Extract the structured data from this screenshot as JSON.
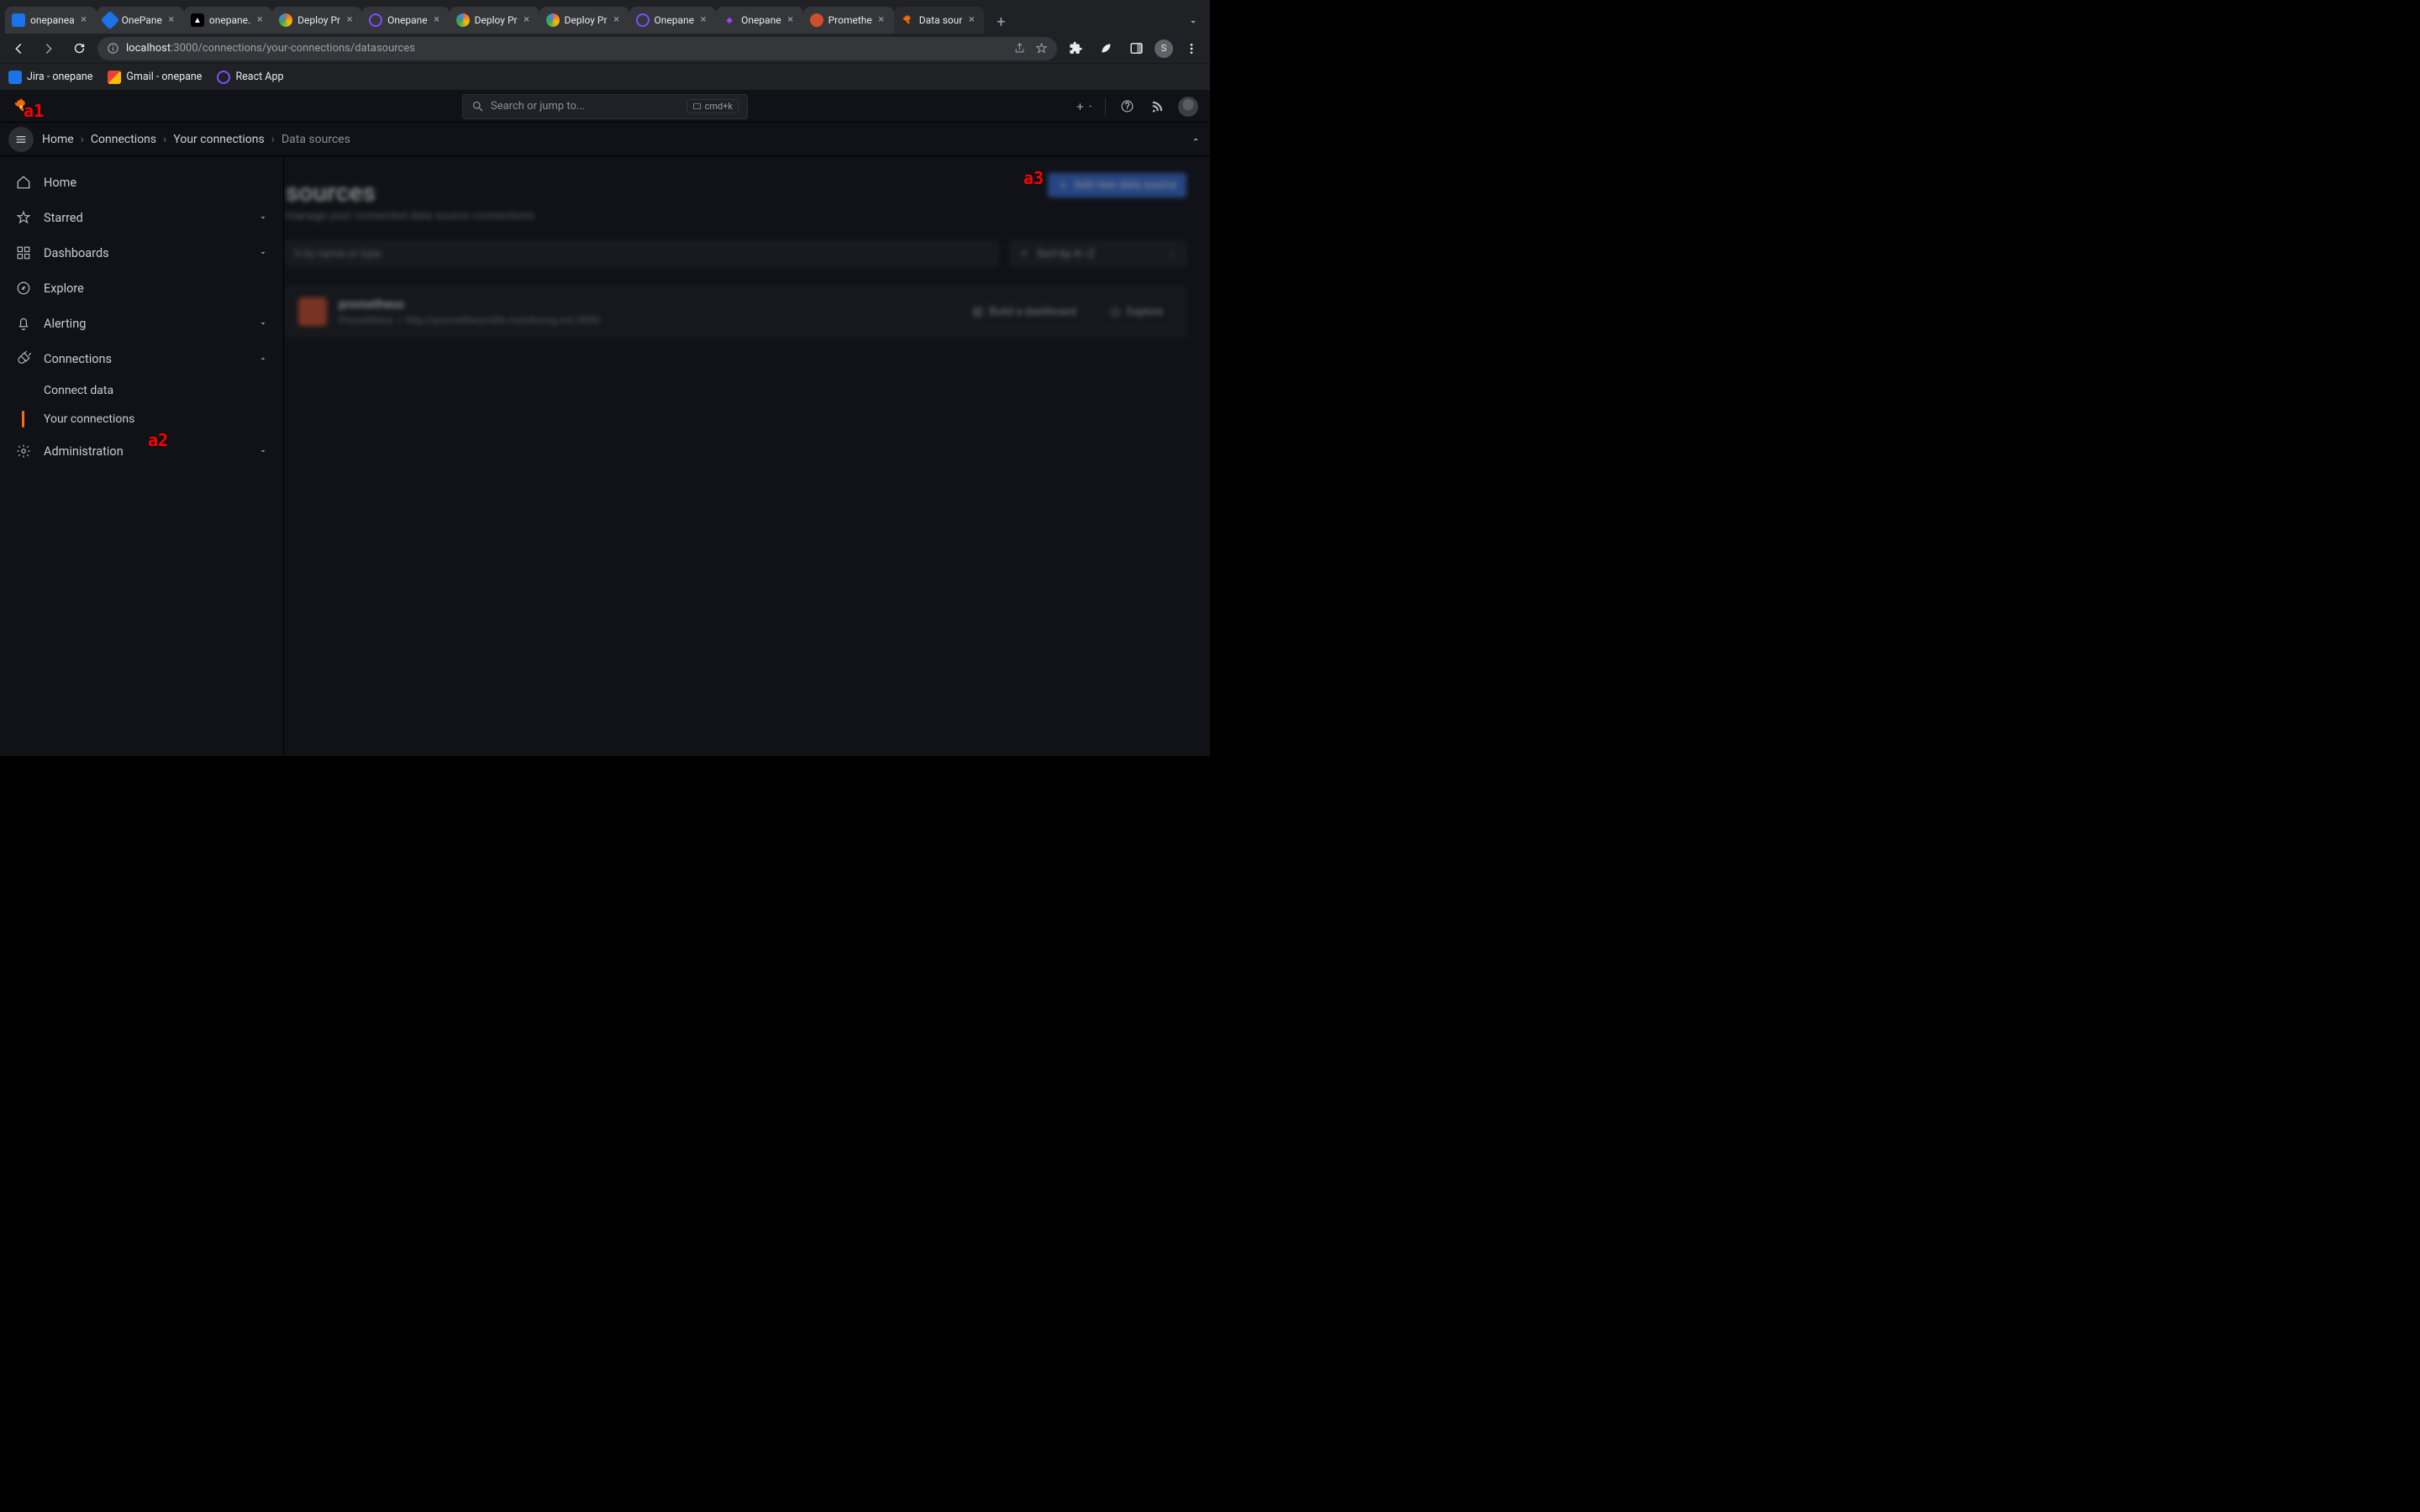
{
  "browser": {
    "tabs": [
      {
        "title": "onepanea",
        "favicon_color": "#1a73e8",
        "favicon_text": ""
      },
      {
        "title": "OnePane",
        "favicon_color": "#1a73e8",
        "favicon_text": ""
      },
      {
        "title": "onepane.",
        "favicon_color": "#ffffff",
        "favicon_text": "▲"
      },
      {
        "title": "Deploy Pr",
        "favicon_color": "#f25c2e",
        "favicon_text": ""
      },
      {
        "title": "Onepane",
        "favicon_color": "#7c4dff",
        "favicon_text": ""
      },
      {
        "title": "Deploy Pr",
        "favicon_color": "#f25c2e",
        "favicon_text": ""
      },
      {
        "title": "Deploy Pr",
        "favicon_color": "#f25c2e",
        "favicon_text": ""
      },
      {
        "title": "Onepane",
        "favicon_color": "#7c4dff",
        "favicon_text": ""
      },
      {
        "title": "Onepane",
        "favicon_color": "",
        "favicon_text": "◆"
      },
      {
        "title": "Promethe",
        "favicon_color": "#cf4f2d",
        "favicon_text": ""
      },
      {
        "title": "Data sour",
        "favicon_color": "#f46800",
        "favicon_text": "",
        "active": true
      }
    ],
    "url_muted_prefix": "localhost",
    "url_rest": ":3000/connections/your-connections/datasources",
    "bookmarks": [
      {
        "label": "Jira - onepane",
        "color": "#1a73e8"
      },
      {
        "label": "Gmail - onepane",
        "color": "#ea4335"
      },
      {
        "label": "React App",
        "color": "#7c4dff"
      }
    ],
    "avatar_letter": "S"
  },
  "app": {
    "search_placeholder": "Search or jump to...",
    "search_shortcut": "cmd+k",
    "breadcrumbs": [
      "Home",
      "Connections",
      "Your connections",
      "Data sources"
    ],
    "sidenav": [
      {
        "label": "Home",
        "icon": "home"
      },
      {
        "label": "Starred",
        "icon": "star",
        "expandable": true
      },
      {
        "label": "Dashboards",
        "icon": "dashboards",
        "expandable": true
      },
      {
        "label": "Explore",
        "icon": "compass"
      },
      {
        "label": "Alerting",
        "icon": "bell",
        "expandable": true
      },
      {
        "label": "Connections",
        "icon": "plug",
        "expandable": true,
        "expanded": true,
        "children": [
          {
            "label": "Connect data"
          },
          {
            "label": "Your connections",
            "active": true
          }
        ]
      },
      {
        "label": "Administration",
        "icon": "gear",
        "expandable": true
      }
    ],
    "page": {
      "title_visible": "sources",
      "subtitle_visible": "manage your connected data source connections",
      "add_button": "Add new data source",
      "search_placeholder_visible": "h by name or type",
      "sort_label": "Sort by A–Z",
      "datasource": {
        "name": "prometheus",
        "type": "Prometheus",
        "url": "http://prometheus-k8s.monitoring.svc:9090",
        "build_btn": "Build a dashboard",
        "explore_btn": "Explore"
      }
    }
  },
  "annotations": {
    "a1": "a1",
    "a2": "a2",
    "a3": "a3"
  }
}
